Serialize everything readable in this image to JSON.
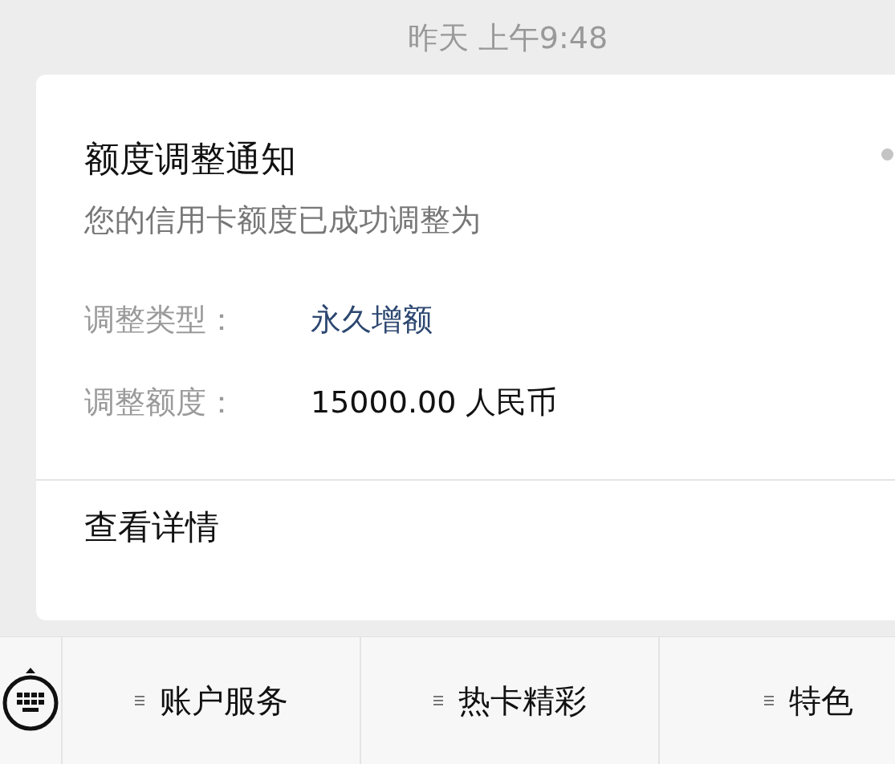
{
  "timestamp": "昨天 上午9:48",
  "message": {
    "title": "额度调整通知",
    "subtitle": "您的信用卡额度已成功调整为",
    "fields": [
      {
        "label": "调整类型：",
        "value": "永久增额",
        "kind": "link"
      },
      {
        "label": "调整额度：",
        "value": "15000.00 人民币",
        "kind": "plain"
      }
    ],
    "action": "查看详情"
  },
  "menu": [
    "账户服务",
    "热卡精彩",
    "特色"
  ]
}
